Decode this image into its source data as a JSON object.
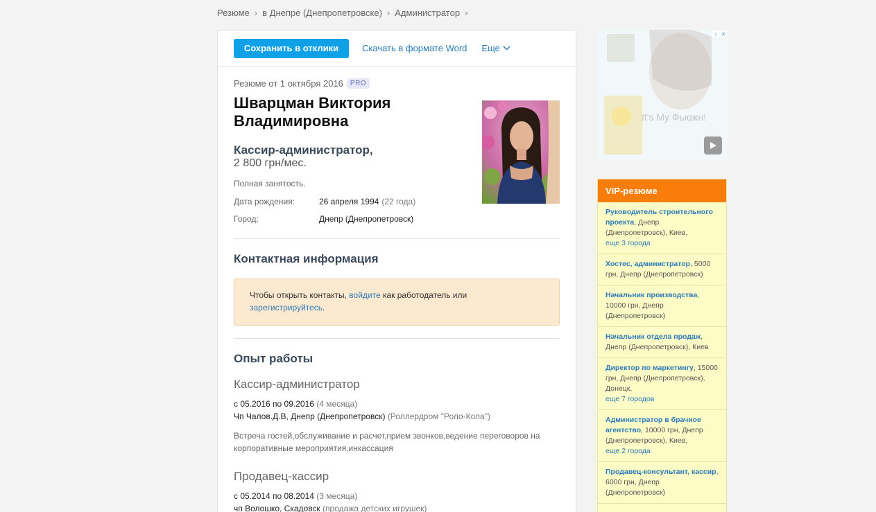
{
  "breadcrumbs": [
    "Резюме",
    "в Днепре (Днепропетровске)",
    "Администратор"
  ],
  "toolbar": {
    "save_label": "Сохранить в отклики",
    "word_label": "Скачать в формате Word",
    "more_label": "Еще"
  },
  "resume": {
    "date": "Резюме от 1 октября 2016",
    "badge": "PRO",
    "name": "Шварцман Виктория Владимировна",
    "position": "Кассир-администратор,",
    "salary": "2 800 грн/мес.",
    "employment": "Полная занятость.",
    "birth_label": "Дата рождения:",
    "birth_value": "26 апреля 1994",
    "birth_age": "(22 года)",
    "city_label": "Город:",
    "city_value": "Днепр (Днепропетровск)"
  },
  "contacts": {
    "heading": "Контактная информация",
    "text_before": "Чтобы открыть контакты, ",
    "login_link": "войдите",
    "text_middle": " как работодатель или",
    "register_link": "зарегистрируйтесь",
    "text_after": "."
  },
  "experience": {
    "heading": "Опыт работы",
    "jobs": [
      {
        "title": "Кассир-администратор",
        "period": "с 05.2016 по 09.2016",
        "duration": "(4 месяца)",
        "company": "Чп Чалов.Д.В, Днепр (Днепропетровск)",
        "company_note": "(Роллердром \"Роло-Кола\")",
        "description": "Встреча гостей,обслуживание и расчет,прием звонков,ведение переговоров на корпоративные мероприятия,инкассация"
      },
      {
        "title": "Продавец-кассир",
        "period": "с 05.2014 по 08.2014",
        "duration": "(3 месяца)",
        "company": "чп Волошко, Скадовск",
        "company_note": "(продажа детских игрушек)"
      }
    ]
  },
  "ad": {
    "text": "It's My Фьюжн!"
  },
  "vip": {
    "heading": "VIP-резюме",
    "items": [
      {
        "title": "Руководитель строительного проекта",
        "details": ", Днепр (Днепропетровск), Киев,",
        "more": "еще 3 города"
      },
      {
        "title": "Хостес, администратор",
        "details": ", 5000 грн, Днепр (Днепропетровск)",
        "more": ""
      },
      {
        "title": "Начальник производства",
        "details": ", 10000 грн, Днепр (Днепропетровск)",
        "more": ""
      },
      {
        "title": "Начальник отдела продаж",
        "details": ", Днепр (Днепропетровск), Киев",
        "more": ""
      },
      {
        "title": "Директор по маркетингу",
        "details": ", 15000 грн, Днепр (Днепропетровск), Донецк,",
        "more": "еще 7 городов"
      },
      {
        "title": "Администратор в брачное агентство",
        "details": ", 10000 грн, Днепр (Днепропетровск), Киев,",
        "more": "еще 2 города"
      },
      {
        "title": "Продавец-консультант, кассир",
        "details": ", 6000 грн, Днепр (Днепропетровск)",
        "more": ""
      }
    ]
  }
}
